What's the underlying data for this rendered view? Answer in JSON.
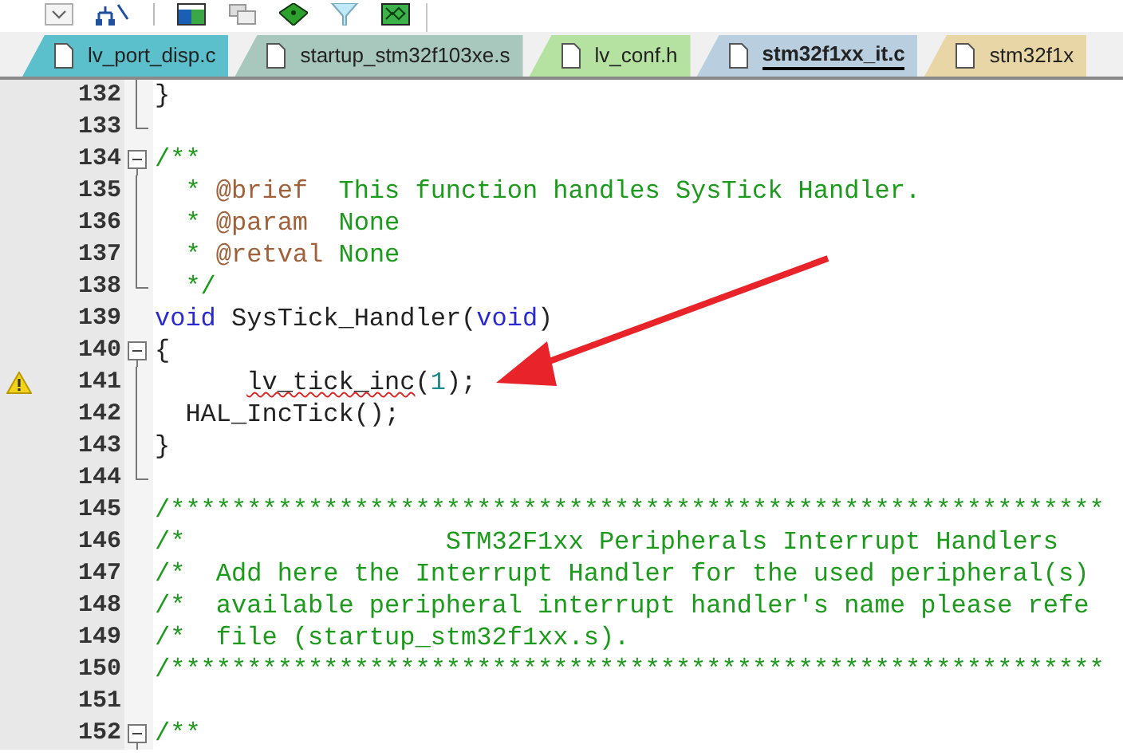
{
  "tabs": [
    {
      "label": "lv_port_disp.c",
      "selected": false,
      "color": "#5bbfcc"
    },
    {
      "label": "startup_stm32f103xe.s",
      "selected": false,
      "color": "#a8c8bd"
    },
    {
      "label": "lv_conf.h",
      "selected": false,
      "color": "#b6e2a1"
    },
    {
      "label": "stm32f1xx_it.c",
      "selected": true,
      "color": "#b9cfe0"
    },
    {
      "label": "stm32f1x",
      "selected": false,
      "color": "#e8d6a6"
    }
  ],
  "editor": {
    "lines": [
      {
        "number": "132",
        "kind": "body",
        "segments": [
          {
            "kind": "plain",
            "text": "}"
          }
        ]
      },
      {
        "number": "133",
        "kind": "end"
      },
      {
        "number": "134",
        "kind": "start",
        "segments": [
          {
            "kind": "comment",
            "text": "/**"
          }
        ]
      },
      {
        "number": "135",
        "kind": "body",
        "segments": [
          {
            "kind": "comment",
            "text": "  * "
          },
          {
            "kind": "doctag",
            "text": "@brief"
          },
          {
            "kind": "comment",
            "text": "  This function handles SysTick Handler."
          }
        ]
      },
      {
        "number": "136",
        "kind": "body",
        "segments": [
          {
            "kind": "comment",
            "text": "  * "
          },
          {
            "kind": "doctag",
            "text": "@param"
          },
          {
            "kind": "comment",
            "text": "  None"
          }
        ]
      },
      {
        "number": "137",
        "kind": "body",
        "segments": [
          {
            "kind": "comment",
            "text": "  * "
          },
          {
            "kind": "doctag",
            "text": "@retval"
          },
          {
            "kind": "comment",
            "text": " None"
          }
        ]
      },
      {
        "number": "138",
        "kind": "end",
        "segments": [
          {
            "kind": "comment",
            "text": "  */"
          }
        ]
      },
      {
        "number": "139",
        "kind": "plain",
        "segments": [
          {
            "kind": "keyword",
            "text": "void"
          },
          {
            "kind": "plain",
            "text": " SysTick_Handler("
          },
          {
            "kind": "keyword",
            "text": "void"
          },
          {
            "kind": "plain",
            "text": ")"
          }
        ]
      },
      {
        "number": "140",
        "kind": "start",
        "segments": [
          {
            "kind": "plain",
            "text": "{"
          }
        ]
      },
      {
        "number": "141",
        "kind": "body",
        "warning": true,
        "segments": [
          {
            "kind": "error",
            "text": "      lv_tick_inc"
          },
          {
            "kind": "plain",
            "text": "("
          },
          {
            "kind": "number",
            "text": "1"
          },
          {
            "kind": "plain",
            "text": ");"
          }
        ]
      },
      {
        "number": "142",
        "kind": "body",
        "segments": [
          {
            "kind": "plain",
            "text": "  HAL_IncTick();"
          }
        ]
      },
      {
        "number": "143",
        "kind": "body",
        "segments": [
          {
            "kind": "plain",
            "text": "}"
          }
        ]
      },
      {
        "number": "144",
        "kind": "end"
      },
      {
        "number": "145",
        "kind": "plain",
        "segments": [
          {
            "kind": "comment",
            "text": "/*************************************************************"
          }
        ]
      },
      {
        "number": "146",
        "kind": "plain",
        "segments": [
          {
            "kind": "comment",
            "text": "/*                 STM32F1xx Peripherals Interrupt Handlers"
          }
        ]
      },
      {
        "number": "147",
        "kind": "plain",
        "segments": [
          {
            "kind": "comment",
            "text": "/*  Add here the Interrupt Handler for the used peripheral(s)"
          }
        ]
      },
      {
        "number": "148",
        "kind": "plain",
        "segments": [
          {
            "kind": "comment",
            "text": "/*  available peripheral interrupt handler's name please refe"
          }
        ]
      },
      {
        "number": "149",
        "kind": "plain",
        "segments": [
          {
            "kind": "comment",
            "text": "/*  file (startup_stm32f1xx.s)."
          }
        ]
      },
      {
        "number": "150",
        "kind": "plain",
        "segments": [
          {
            "kind": "comment",
            "text": "/*************************************************************"
          }
        ]
      },
      {
        "number": "151",
        "kind": "plain"
      },
      {
        "number": "152",
        "kind": "start",
        "segments": [
          {
            "kind": "comment",
            "text": "/**"
          }
        ]
      }
    ]
  }
}
